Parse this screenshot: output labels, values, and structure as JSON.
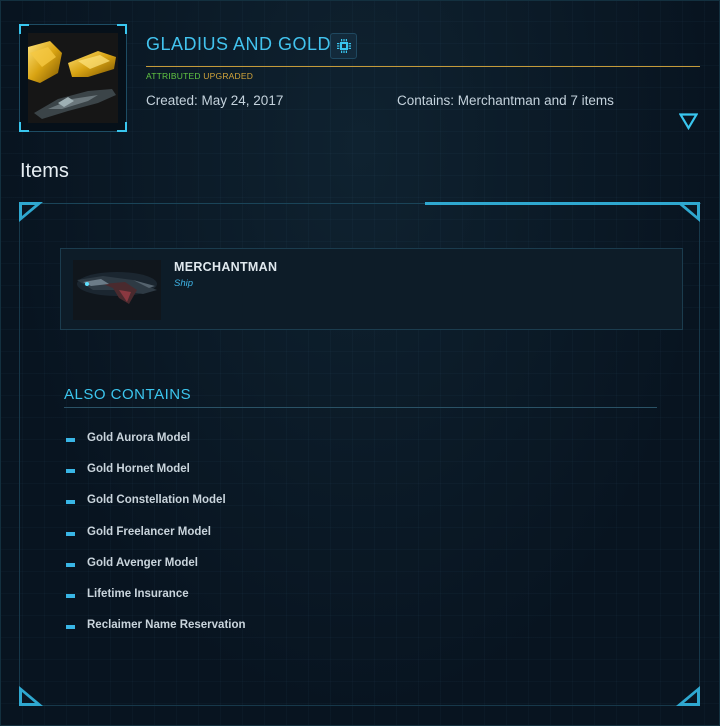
{
  "pledge": {
    "title": "GLADIUS AND GOLD",
    "tags": {
      "attributed": "ATTRIBUTED",
      "upgraded": "UPGRADED"
    },
    "created": "Created: May 24, 2017",
    "contains": "Contains: Merchantman and 7 items",
    "chip_icon": "chip-icon",
    "expand_icon": "triangle-down-icon"
  },
  "items_section": {
    "title": "Items",
    "ship": {
      "name": "MERCHANTMAN",
      "type": "Ship"
    },
    "also_contains_title": "ALSO CONTAINS",
    "also_contains": [
      "Gold Aurora Model",
      "Gold Hornet Model",
      "Gold Constellation Model",
      "Gold Freelancer Model",
      "Gold Avenger Model",
      "Lifetime Insurance",
      "Reclaimer Name Reservation"
    ]
  },
  "colors": {
    "accent_cyan": "#42c3ee",
    "gold": "#c49a3a",
    "attributed_green": "#62c643",
    "background": "#0a1622"
  }
}
